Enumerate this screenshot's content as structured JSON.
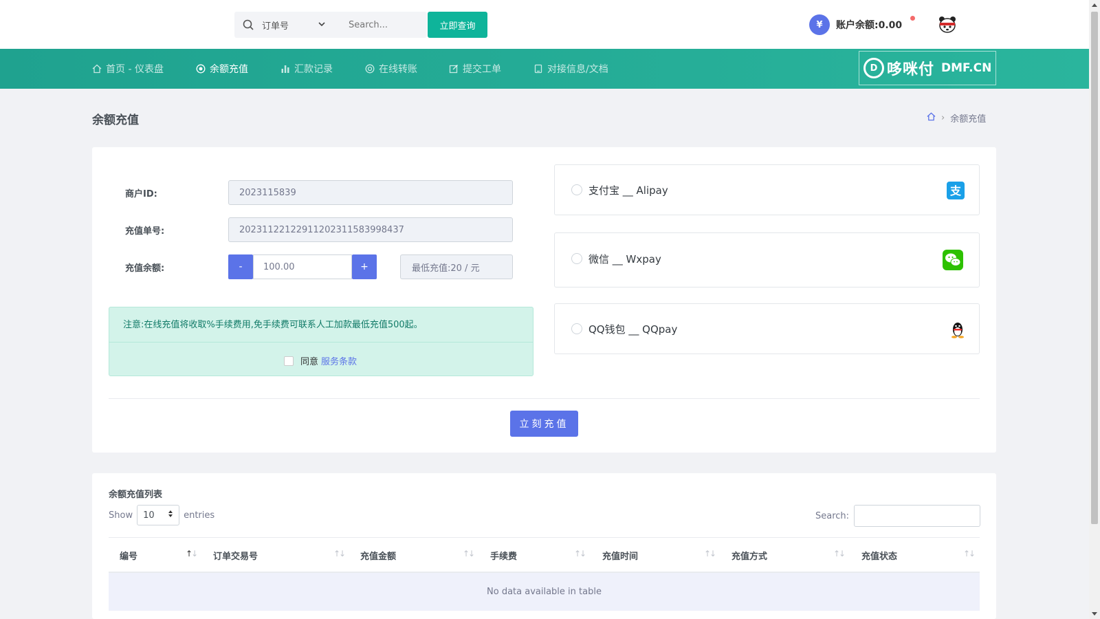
{
  "topbar": {
    "search_type": "订单号",
    "search_placeholder": "Search...",
    "search_button": "立即查询",
    "balance_label": "账户余额:0.00"
  },
  "nav": {
    "items": [
      {
        "label": "首页 - 仪表盘"
      },
      {
        "label": "余额充值"
      },
      {
        "label": "汇款记录"
      },
      {
        "label": "在线转账"
      },
      {
        "label": "提交工单"
      },
      {
        "label": "对接信息/文档"
      }
    ],
    "logo_cn": "哆咪付",
    "logo_en": "DMF.CN",
    "logo_mark": "D"
  },
  "page": {
    "title": "余额充值",
    "breadcrumb_current": "余额充值"
  },
  "form": {
    "merchant_label": "商户ID:",
    "merchant_value": "2023115839",
    "order_label": "充值单号:",
    "order_value": "2023112212291120231158399843​7",
    "amount_label": "充值余额:",
    "minus": "-",
    "plus": "+",
    "amount_value": "100.00",
    "min_label": "最低充值:20 / 元",
    "notice": "注意:在线充值将收取%手续费用,免手续费可联系人工加款最低充值500起。",
    "agree_text": "同意",
    "terms_link": "服务条款",
    "submit": "立刻充值"
  },
  "payments": [
    {
      "label": "支付宝 __ Alipay",
      "icon": "alipay-icon",
      "color": "#1aa0e8"
    },
    {
      "label": "微信 __ Wxpay",
      "icon": "wechat-icon",
      "color": "#2dc100"
    },
    {
      "label": "QQ钱包 __ QQpay",
      "icon": "qq-icon",
      "color": "#111111"
    }
  ],
  "table": {
    "title": "余额充值列表",
    "show": "Show",
    "length": "10",
    "entries": "entries",
    "search_label": "Search:",
    "columns": [
      "编号",
      "订单交易号",
      "充值金额",
      "手续费",
      "充值时间",
      "充值方式",
      "充值状态"
    ],
    "empty": "No data available in table"
  },
  "colors": {
    "accent": "#5b73e8",
    "nav": "#21a890",
    "search_btn": "#0eb49a"
  }
}
